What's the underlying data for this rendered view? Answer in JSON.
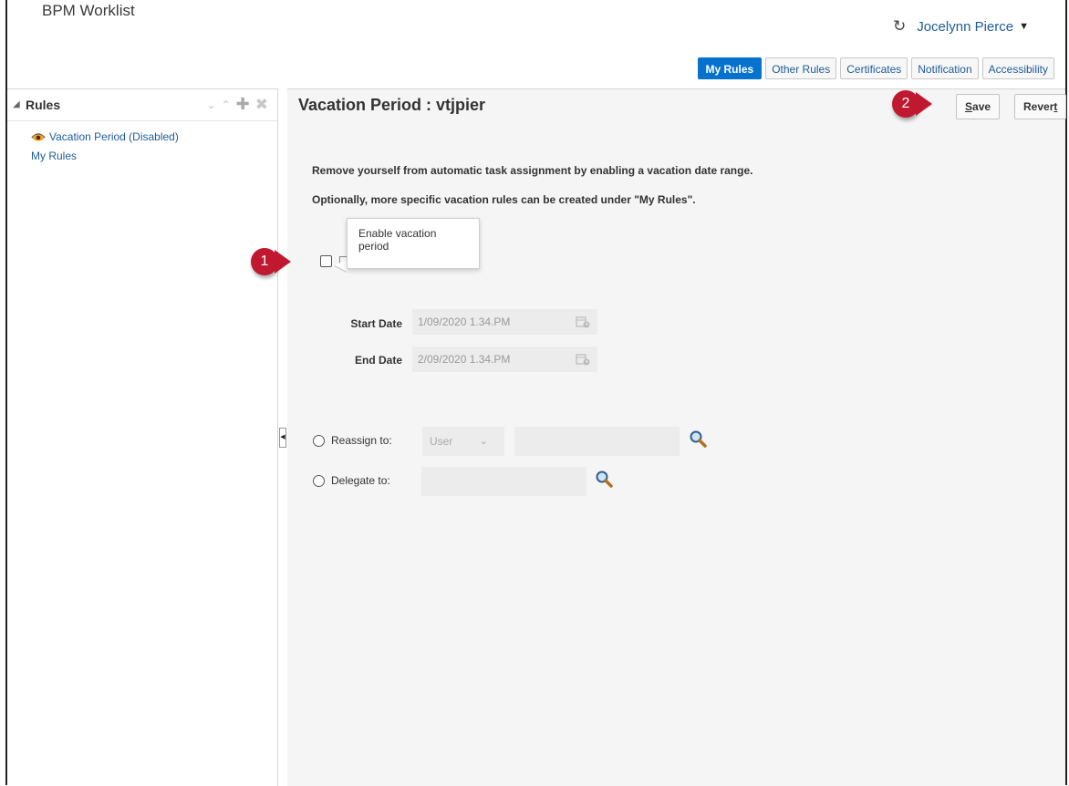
{
  "header": {
    "app_title": "BPM Worklist",
    "user_name": "Jocelynn Pierce",
    "icons": {
      "refresh": "refresh-icon",
      "user_menu": "caret-down-icon"
    }
  },
  "tabs": [
    {
      "label": "My Rules",
      "active": true
    },
    {
      "label": "Other Rules",
      "active": false
    },
    {
      "label": "Certificates",
      "active": false
    },
    {
      "label": "Notification",
      "active": false
    },
    {
      "label": "Accessibility",
      "active": false
    }
  ],
  "sidebar": {
    "title": "Rules",
    "tools": [
      "chevron-down-icon",
      "chevron-up-icon",
      "add-icon",
      "delete-icon"
    ],
    "items": [
      {
        "label": "Vacation Period (Disabled)",
        "icon": "eye-icon"
      },
      {
        "label": "My Rules"
      }
    ]
  },
  "main": {
    "title": "Vacation Period : vtjpier",
    "save_label_pre": "",
    "save_label_u": "S",
    "save_label_post": "ave",
    "revert_label_pre": "Rever",
    "revert_label_u": "t",
    "intro_1": "Remove yourself from automatic task assignment by enabling a vacation date range.",
    "intro_2": "Optionally, more specific vacation rules can be created under \"My Rules\".",
    "tooltip": "Enable vacation period",
    "enable_checked": false,
    "start_date_label": "Start Date",
    "start_date_value": "1/09/2020 1.34.PM",
    "end_date_label": "End Date",
    "end_date_value": "2/09/2020 1.34.PM",
    "reassign_label": "Reassign to:",
    "reassign_type": "User",
    "delegate_label": "Delegate to:"
  },
  "callouts": {
    "one": "1",
    "two": "2"
  },
  "colors": {
    "accent": "#0572ce",
    "callout": "#c0182f",
    "link": "#1f5c99"
  }
}
